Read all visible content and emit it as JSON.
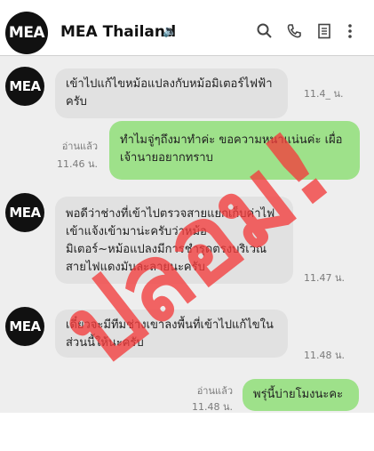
{
  "header": {
    "avatar_text": "MEA",
    "title": "MEA Thailand",
    "speaker_icon": "speaker-icon",
    "icons": [
      "search-icon",
      "phone-icon",
      "menu-list-icon",
      "more-vertical-icon"
    ]
  },
  "messages": [
    {
      "side": "left",
      "avatar": "MEA",
      "text": "เข้าไปแก้ไขหม้อแปลงกับหม้อมิเตอร์ไฟฟ้าครับ",
      "time": "11.4_ น."
    },
    {
      "side": "right",
      "read": "อ่านแล้ว",
      "time": "11.46 น.",
      "text": "ทำไมจู่ๆถึงมาทำค่ะ ขอความหนาแน่นค่ะ เผื่อเจ้านายอยากทราบ"
    },
    {
      "side": "left",
      "avatar": "MEA",
      "text": "พอดีว่าช่างที่เข้าไปตรวจสายแยกเก็บค่าไฟเข้าแจ้งเข้ามาน่ะครับว่าหม้อมิเตอร์~หม้อแปลงมีการชำรุดตรงบริเวณสายไฟแดงมันละลายนะครับ",
      "time": "11.47 น."
    },
    {
      "side": "left",
      "avatar": "MEA",
      "text": "เดี๋ยวจะมีทีมช่างเขาลงพื้นที่เข้าไปแก้ไขในส่วนนี้ให้นะครับ",
      "time": "11.48 น."
    },
    {
      "side": "right",
      "read": "อ่านแล้ว",
      "time": "11.48 น.",
      "text": "พรุ่นี้บ่ายโมงนะคะ"
    }
  ],
  "stamp": "ปลอม!",
  "colors": {
    "stamp": "#f23c3c",
    "green_bubble": "#9ee18a",
    "grey_bubble": "#e1e1e1",
    "chat_bg": "#eeeeee"
  }
}
